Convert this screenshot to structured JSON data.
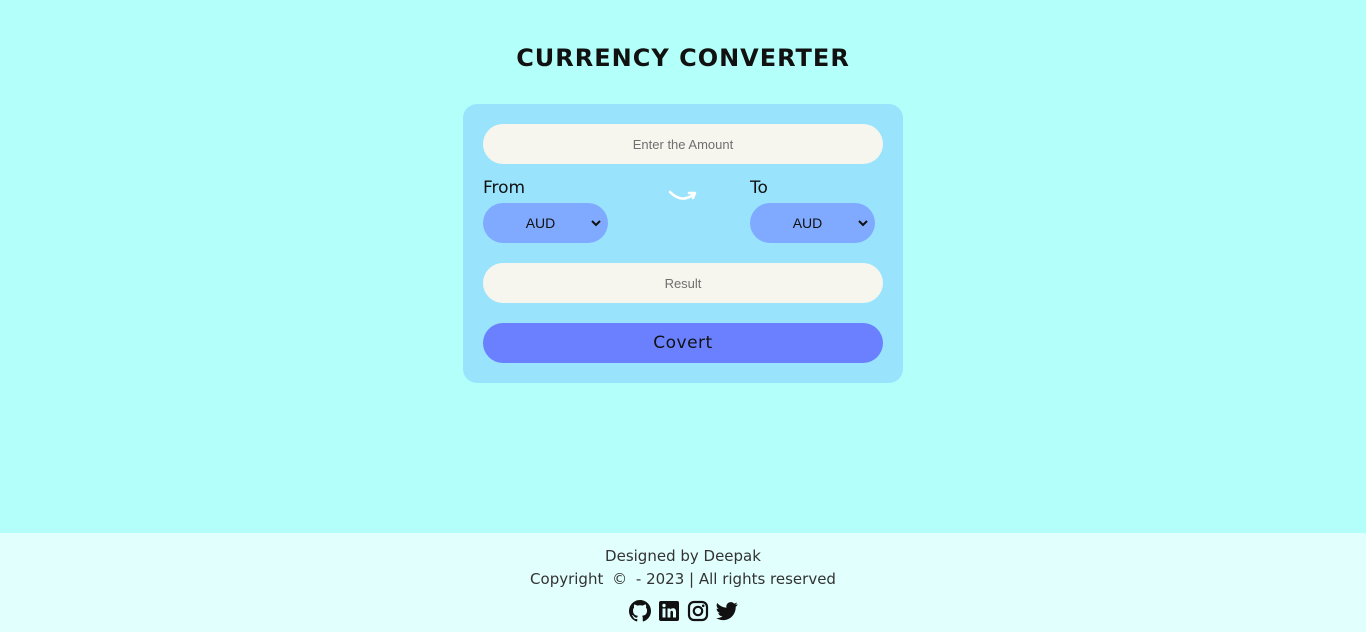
{
  "header": {
    "title": "CURRENCY CONVERTER"
  },
  "form": {
    "amount_placeholder": "Enter the Amount",
    "from_label": "From",
    "to_label": "To",
    "from_value": "AUD",
    "to_value": "AUD",
    "result_placeholder": "Result",
    "convert_label": "Covert"
  },
  "icons": {
    "swap": "swap-arrow-icon",
    "social": [
      "github-icon",
      "linkedin-icon",
      "instagram-icon",
      "twitter-icon"
    ]
  },
  "footer": {
    "designed_by": "Designed by Deepak",
    "copyright_prefix": "Copyright",
    "copyright_symbol": "©",
    "copyright_suffix": "- 2023 | All rights reserved"
  },
  "colors": {
    "background": "#b3fff9",
    "card": "#99e4fc",
    "select": "#80aaff",
    "button": "#6a80ff",
    "input": "#f7f6ee",
    "footer": "#e1fffd"
  }
}
